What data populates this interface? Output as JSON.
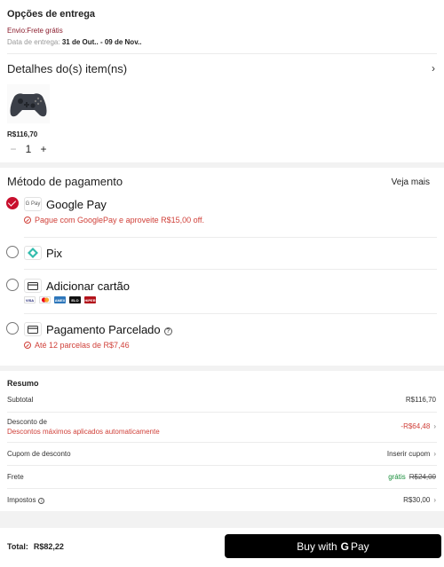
{
  "delivery": {
    "title": "Opções de entrega",
    "shipping": "Envio:Frete grátis",
    "date_label": "Data de entrega:",
    "date_value": "31 de Out.. - 09 de Nov.."
  },
  "item_details": {
    "title": "Detalhes do(s) item(ns)",
    "price": "R$116,70",
    "quantity": "1",
    "minus": "−",
    "plus": "+",
    "chevron": "›"
  },
  "payment": {
    "title": "Método de pagamento",
    "see_more": "Veja mais",
    "methods": [
      {
        "name": "Google Pay",
        "logo": "G Pay",
        "selected": true,
        "note": "Pague com GooglePay e aproveite R$15,00 off."
      },
      {
        "name": "Pix",
        "logo": "pix-icon",
        "selected": false
      },
      {
        "name": "Adicionar cartão",
        "logo": "card-icon",
        "selected": false,
        "cards": [
          "VISA",
          "MC",
          "AMEX",
          "ELO",
          "HIPER"
        ]
      },
      {
        "name": "Pagamento Parcelado",
        "logo": "card-icon",
        "selected": false,
        "help": "?",
        "note": "Até 12 parcelas de R$7,46"
      }
    ]
  },
  "summary": {
    "title": "Resumo",
    "subtotal_label": "Subtotal",
    "subtotal_value": "R$116,70",
    "discount_label": "Desconto de",
    "discount_sub": "Descontos máximos aplicados automaticamente",
    "discount_value": "-R$64,48",
    "coupon_label": "Cupom de desconto",
    "coupon_value": "Inserir cupom",
    "shipping_label": "Frete",
    "shipping_free": "grátis",
    "shipping_old": "R$24,00",
    "taxes_label": "Impostos",
    "taxes_value": "R$30,00",
    "arrow": "›",
    "info": "i"
  },
  "bottom": {
    "total_label": "Total:",
    "total_value": "R$82,22",
    "buy_prefix": "Buy with",
    "buy_g": "G",
    "buy_suffix": "Pay"
  },
  "colors": {
    "accent": "#c8102e",
    "promo": "#d0413a",
    "free": "#1a8f3c",
    "button": "#000000"
  }
}
